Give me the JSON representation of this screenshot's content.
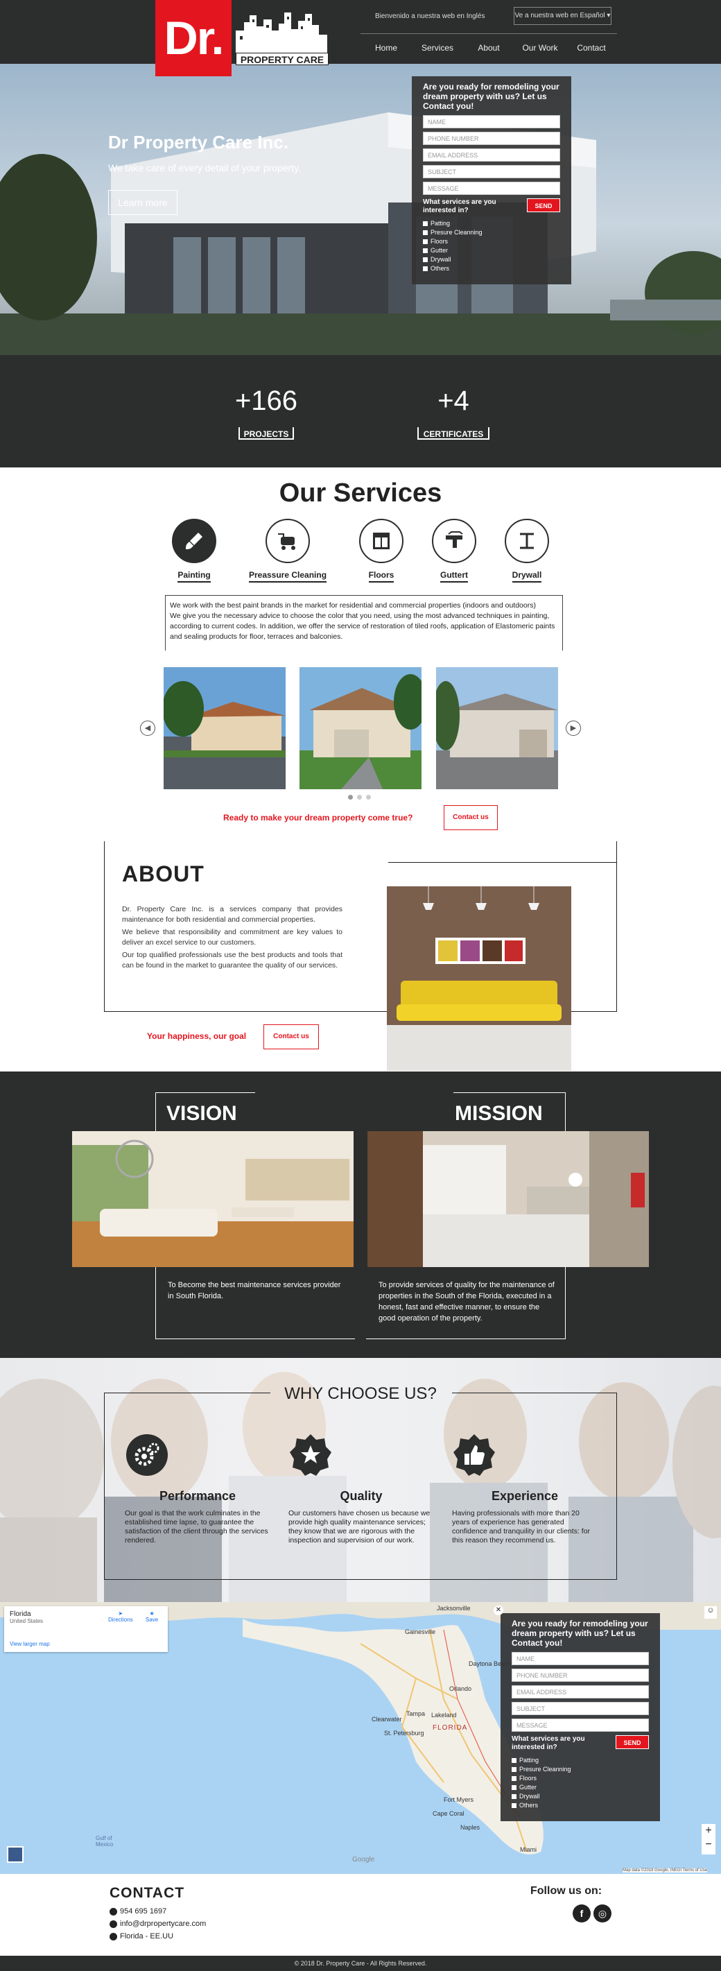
{
  "header": {
    "logo_mark": "Dr.",
    "logo_text": "PROPERTY CARE",
    "welcome": "Bienvenido a nuestra web en Inglés",
    "lang_button": "Ve a nuestra web en Español ▾",
    "nav": [
      "Home",
      "Services",
      "About",
      "Our Work",
      "Contact"
    ]
  },
  "hero": {
    "title": "Dr Property Care Inc.",
    "subtitle": "We take care of every detail of your property.",
    "button": "Learn more"
  },
  "form": {
    "title": "Are you ready for remodeling your dream property with us? Let us Contact you!",
    "placeholders": [
      "NAME",
      "PHONE NUMBER",
      "EMAIL ADDRESS",
      "SUBJECT",
      "MESSAGE"
    ],
    "question": "What services are you interested in?",
    "send": "SEND",
    "options": [
      "Patting",
      "Presure Cleanning",
      "Floors",
      "Gutter",
      "Drywall",
      "Others"
    ]
  },
  "stats": [
    {
      "value": "+166",
      "label": "PROJECTS"
    },
    {
      "value": "+4",
      "label": "CERTIFICATES"
    }
  ],
  "services": {
    "title": "Our Services",
    "items": [
      {
        "label": "Painting",
        "icon": "paint-brush-icon"
      },
      {
        "label": "Preassure Cleaning",
        "icon": "pressure-washer-icon"
      },
      {
        "label": "Floors",
        "icon": "floor-tiles-icon"
      },
      {
        "label": "Guttert",
        "icon": "gutter-icon"
      },
      {
        "label": "Drywall",
        "icon": "drywall-icon"
      }
    ],
    "description_1": "We work with the best paint brands in the market for residential and commercial properties (indoors and outdoors)",
    "description_2": "We give you the necessary advice to choose the color that you need, using the most advanced techniques in painting, according to current codes. In addition, we offer the service of restoration of tiled roofs, application of Elastomeric paints and sealing products for floor, terraces and balconies.",
    "cta_text": "Ready to make your dream property come true?",
    "cta_button": "Contact us"
  },
  "about": {
    "title": "ABOUT",
    "paragraphs": [
      "Dr. Property Care Inc. is a services company that provides maintenance for both residential and commercial properties.",
      "We believe that responsibility and commitment are key values to deliver an excel service to our customers.",
      "Our top qualified professionals use the best products and tools that can be found in the market to guarantee the quality of our services."
    ],
    "cta_text": "Your happiness, our goal",
    "cta_button": "Contact us"
  },
  "vision": {
    "title": "VISION",
    "text": "To Become the best maintenance services provider in South Florida."
  },
  "mission": {
    "title": "MISSION",
    "text": "To provide services of quality for the maintenance of properties in the South of the Florida, executed in a honest, fast and effective manner, to ensure the good operation of the property."
  },
  "why": {
    "title": "WHY CHOOSE US?",
    "items": [
      {
        "head": "Performance",
        "icon": "gears-icon",
        "text": "Our goal is that the work culminates in the established time lapse, to guarantee the satisfaction of the client through the services rendered."
      },
      {
        "head": "Quality",
        "icon": "star-badge-icon",
        "text": "Our customers have chosen us because we provide high quality maintenance services; they know that we are rigorous with the inspection and supervision of our work."
      },
      {
        "head": "Experience",
        "icon": "thumbs-up-icon",
        "text": "Having professionals with more than 20 years of experience has generated confidence and tranquility in our clients: for this reason they recommend us."
      }
    ]
  },
  "map": {
    "place": "Florida",
    "country": "United States",
    "directions": "Directions",
    "save": "Save",
    "larger": "View larger map",
    "label_florida": "FLORIDA",
    "cities": [
      "Jacksonville",
      "Gainesville",
      "Orlando",
      "Tampa",
      "Clearwater",
      "St. Petersburg",
      "Lakeland",
      "Daytona Beach",
      "Miami",
      "Fort Myers",
      "Naples",
      "Cape Coral"
    ],
    "footer": "Map data ©2018 Google, INEGI   Terms of Use",
    "google": "Google",
    "gulf": "Gulf of Mexico"
  },
  "contact": {
    "title": "CONTACT",
    "phone": "954 695 1697",
    "email": "info@drpropertycare.com",
    "location": "Florida - EE.UU",
    "follow": "Follow us on:",
    "facebook": "f",
    "instagram": "◎"
  },
  "copyright": "© 2018 Dr. Property Care - All Rights Reserved."
}
